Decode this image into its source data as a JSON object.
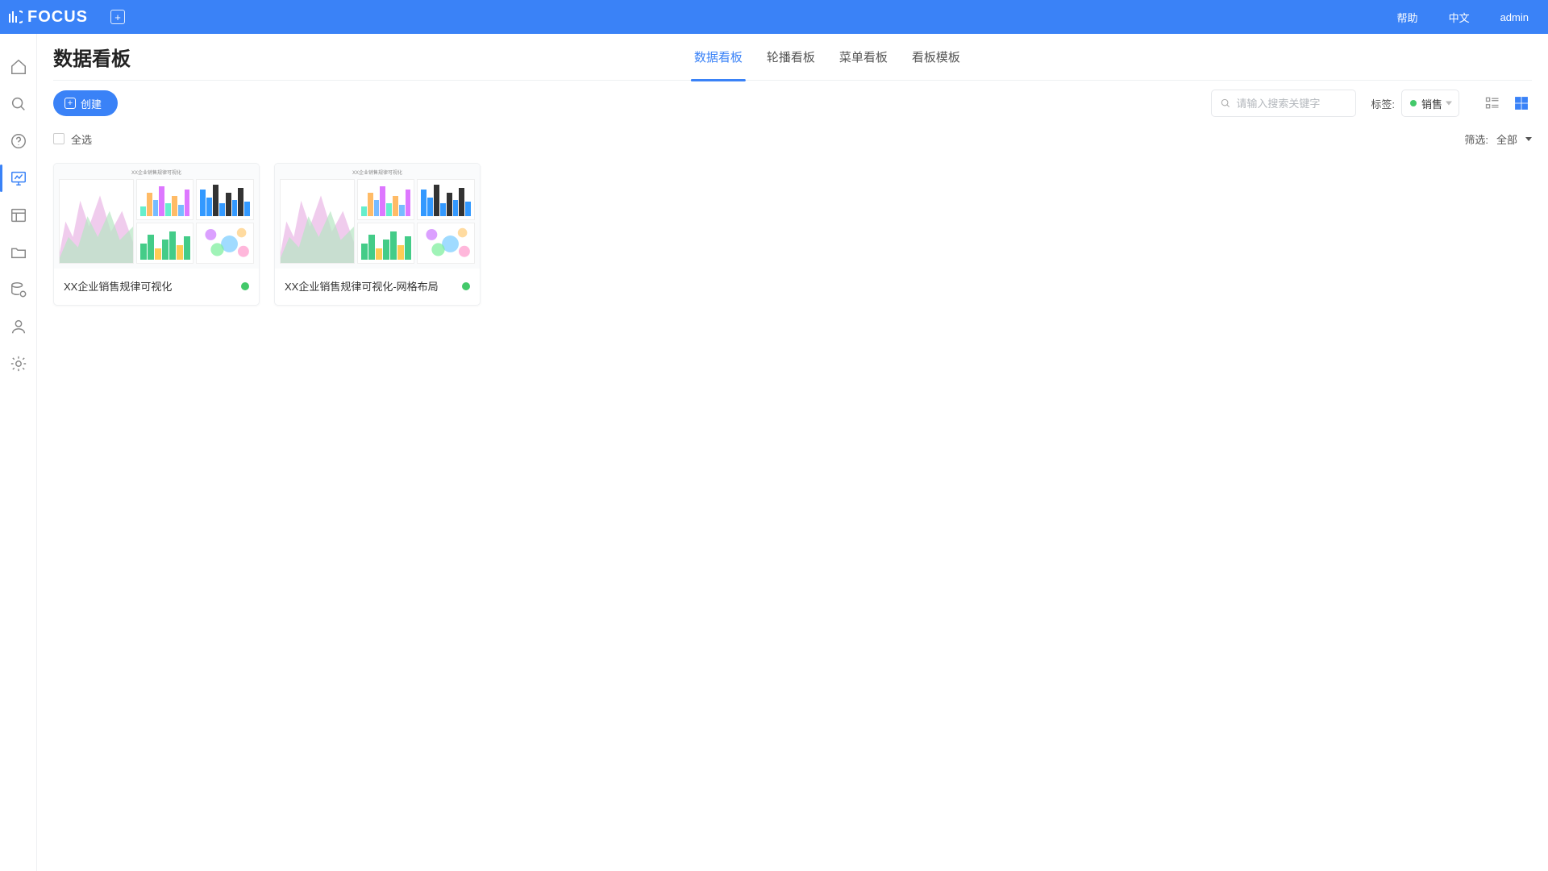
{
  "brand": "FOCUS",
  "top_links": {
    "help": "帮助",
    "lang": "中文",
    "user": "admin"
  },
  "page_title": "数据看板",
  "tabs": [
    {
      "label": "数据看板",
      "active": true
    },
    {
      "label": "轮播看板",
      "active": false
    },
    {
      "label": "菜单看板",
      "active": false
    },
    {
      "label": "看板模板",
      "active": false
    }
  ],
  "create_label": "创建",
  "search": {
    "placeholder": "请输入搜索关键字"
  },
  "tag_label": "标签:",
  "tag_value": "销售",
  "select_all_label": "全选",
  "filter_label": "筛选:",
  "filter_value": "全部",
  "thumb_header": "XX企业销售规律可视化",
  "cards": [
    {
      "name": "XX企业销售规律可视化"
    },
    {
      "name": "XX企业销售规律可视化-网格布局"
    }
  ],
  "colors": {
    "primary": "#3a82f7",
    "green": "#43c96a"
  }
}
